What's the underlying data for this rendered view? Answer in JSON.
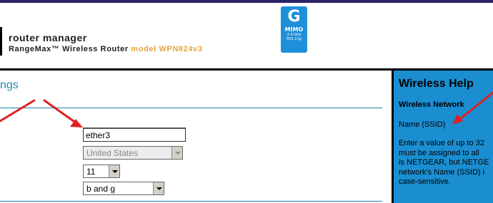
{
  "header": {
    "title": "router manager",
    "subtitle_product": "RangeMax™ Wireless Router ",
    "subtitle_model": "model WPN824v3",
    "badge": {
      "letter": "G",
      "label": "MIMO",
      "small1": "2.4 GHz",
      "small2": "802.11g",
      "color": "#1e8fd8"
    }
  },
  "main": {
    "section_title": "ngs",
    "ssid_value": "ether3",
    "region_value": "United States",
    "channel_value": "11",
    "mode_value": "b and g"
  },
  "help": {
    "heading": "Wireless Help",
    "subheading": "Wireless Network",
    "name_label": "Name (SSID)",
    "body_lines": [
      "Enter a value of up to 32",
      "must be assigned to all",
      "is NETGEAR, but NETGE",
      "network's Name (SSID) i",
      "case-sensitive."
    ],
    "color": "#1a8ed1"
  },
  "annotations": {
    "arrow_color": "#e02020"
  }
}
